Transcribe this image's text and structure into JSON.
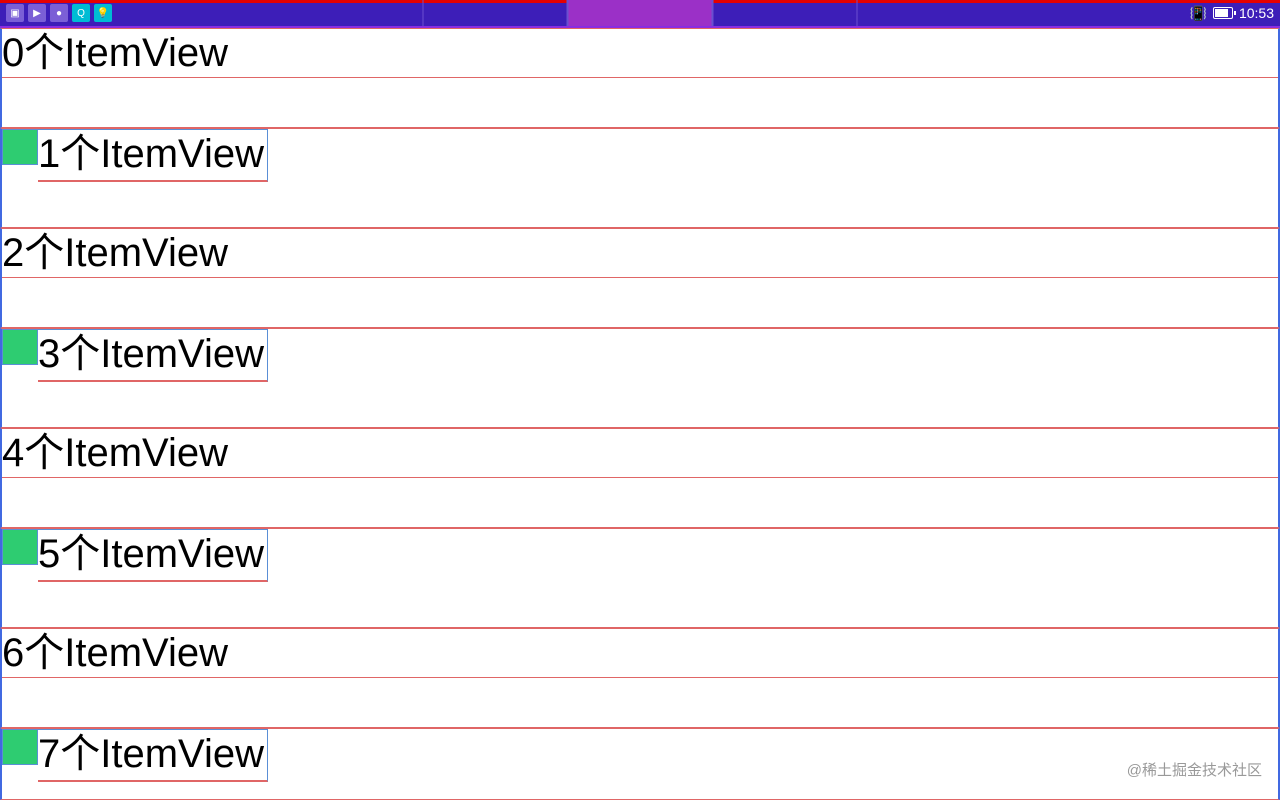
{
  "status_bar": {
    "time": "10:53",
    "left_icons": [
      "app-icon",
      "video-icon",
      "record-icon",
      "search-icon",
      "bulb-icon"
    ],
    "right_icons": [
      "vibrate-icon",
      "battery-icon"
    ]
  },
  "list": {
    "items": [
      {
        "label": "0个ItemView",
        "has_green_box": false
      },
      {
        "label": "1个ItemView",
        "has_green_box": true
      },
      {
        "label": "2个ItemView",
        "has_green_box": false
      },
      {
        "label": "3个ItemView",
        "has_green_box": true
      },
      {
        "label": "4个ItemView",
        "has_green_box": false
      },
      {
        "label": "5个ItemView",
        "has_green_box": true
      },
      {
        "label": "6个ItemView",
        "has_green_box": false
      },
      {
        "label": "7个ItemView",
        "has_green_box": true
      }
    ]
  },
  "watermark": "@稀土掘金技术社区"
}
